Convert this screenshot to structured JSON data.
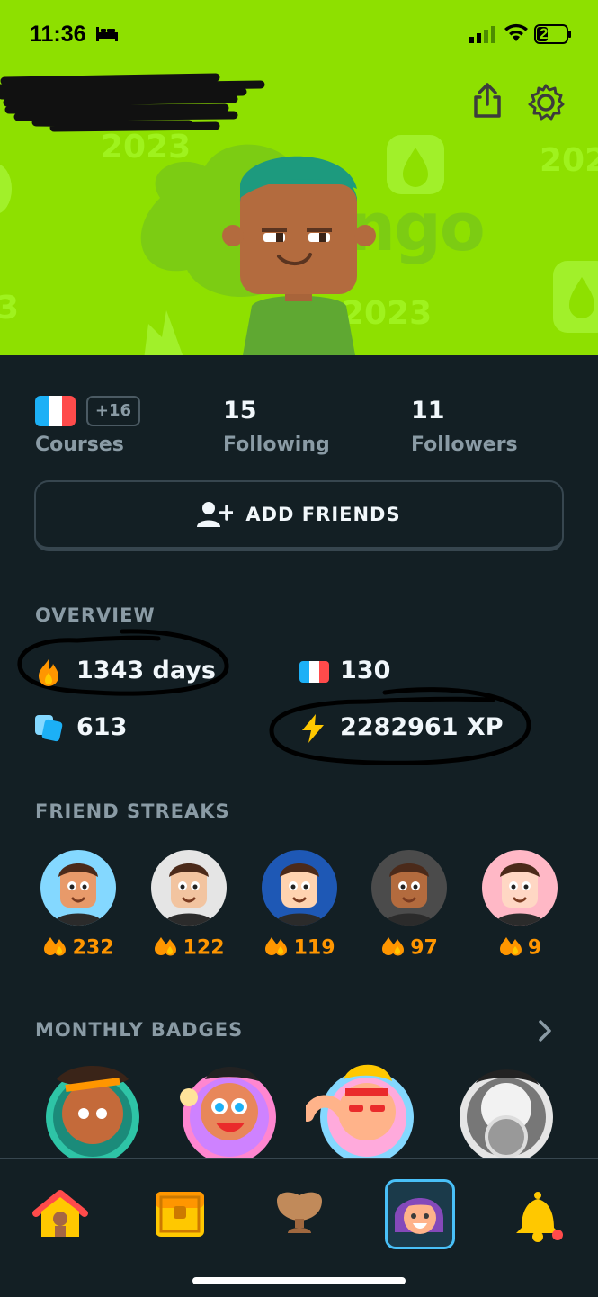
{
  "status_bar": {
    "time": "11:36",
    "battery": "27"
  },
  "header": {
    "bg_words": [
      "2023",
      "duolingo",
      "2023",
      "202",
      "3"
    ],
    "icons": [
      "share-icon",
      "gear-icon"
    ]
  },
  "stats": {
    "courses_extra": "+16",
    "courses_label": "Courses",
    "following_count": "15",
    "following_label": "Following",
    "followers_count": "11",
    "followers_label": "Followers"
  },
  "add_friends_label": "ADD FRIENDS",
  "overview": {
    "title": "OVERVIEW",
    "streak": "1343 days",
    "french_score": "130",
    "crowns": "613",
    "xp": "2282961 XP"
  },
  "friend_streaks": {
    "title": "FRIEND STREAKS",
    "items": [
      {
        "count": "232",
        "color": "#84d8ff"
      },
      {
        "count": "122",
        "color": "#e5e5e5"
      },
      {
        "count": "119",
        "color": "#1e58b5"
      },
      {
        "count": "97",
        "color": "#4b4b4b"
      },
      {
        "count": "9",
        "color": "#ffb8c6"
      }
    ]
  },
  "monthly_badges": {
    "title": "MONTHLY BADGES"
  },
  "tab_bar": [
    "home-icon",
    "chest-icon",
    "trophy-icon",
    "profile-icon",
    "bell-icon"
  ],
  "colors": {
    "accent_green": "#8ee000",
    "streak_orange": "#ff9600",
    "bg_dark": "#131f24",
    "selected_blue": "#49c0f8"
  }
}
